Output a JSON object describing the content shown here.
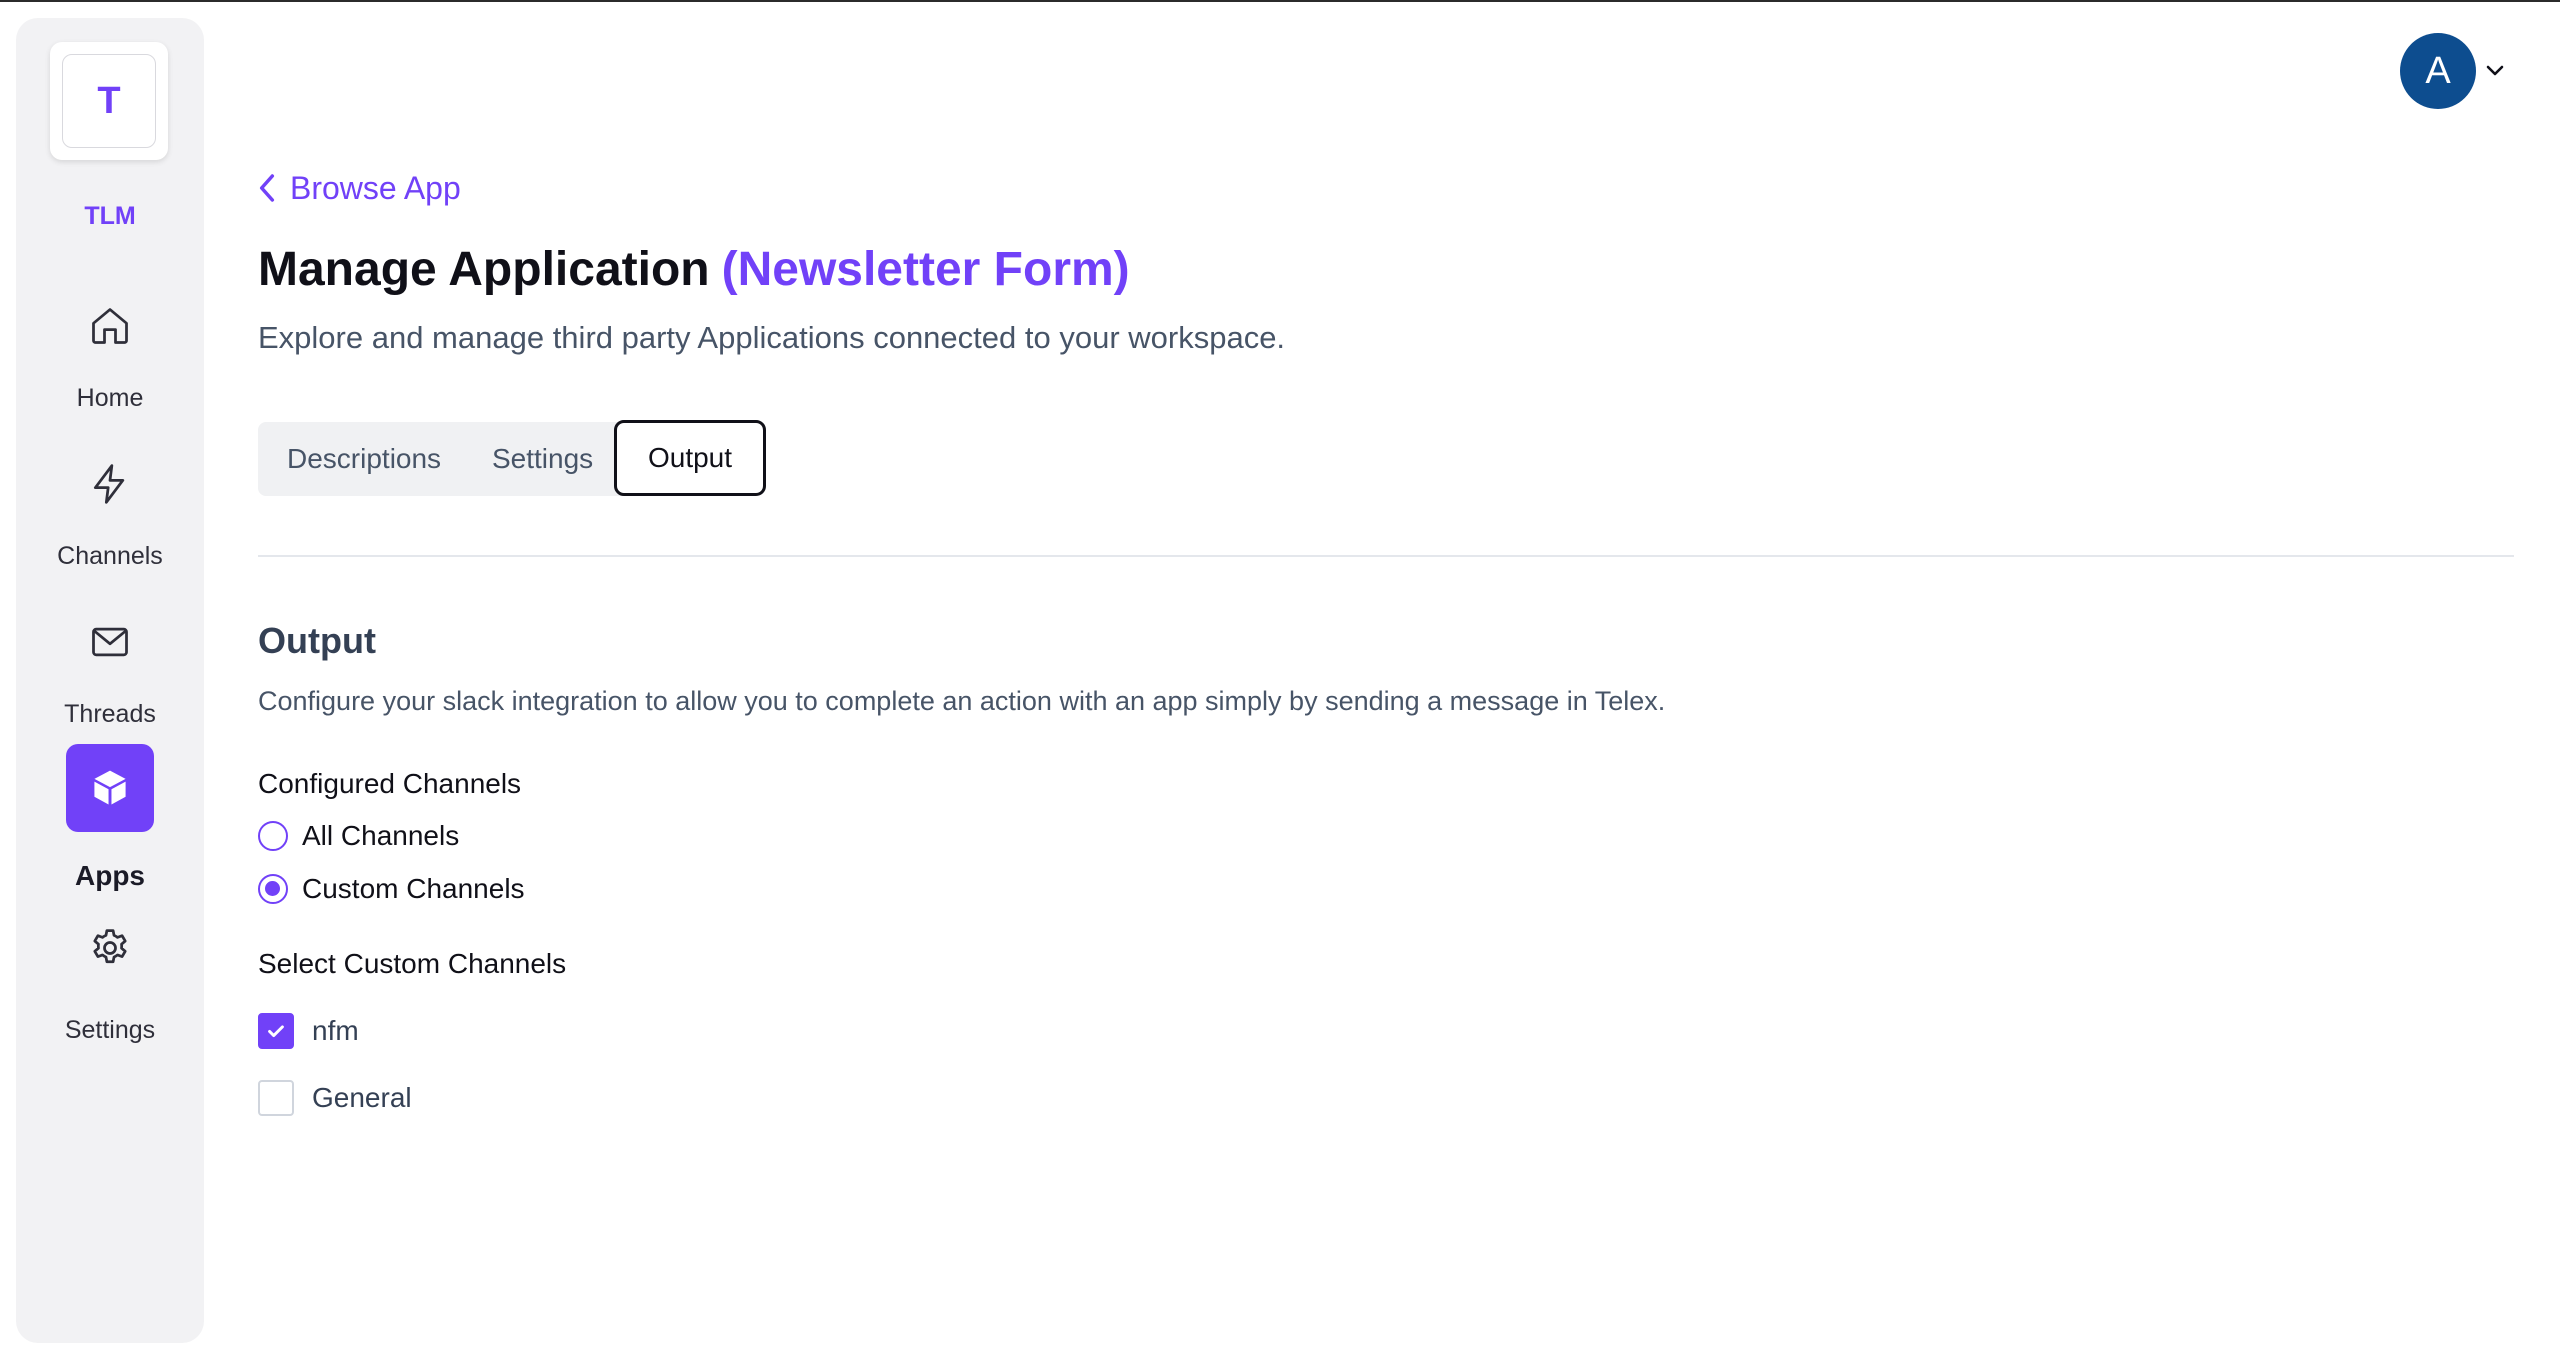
{
  "workspace": {
    "initial": "T",
    "name": "TLM"
  },
  "sidebar": {
    "items": [
      {
        "label": "Home",
        "icon": "home-icon",
        "active": false
      },
      {
        "label": "Channels",
        "icon": "lightning-icon",
        "active": false
      },
      {
        "label": "Threads",
        "icon": "mail-icon",
        "active": false
      },
      {
        "label": "Apps",
        "icon": "cube-icon",
        "active": true
      },
      {
        "label": "Settings",
        "icon": "gear-icon",
        "active": false
      }
    ]
  },
  "user": {
    "avatar_initial": "A"
  },
  "breadcrumb": {
    "back_label": "Browse App"
  },
  "header": {
    "title": "Manage Application",
    "app_name": "(Newsletter Form)",
    "subtitle": "Explore and manage third party Applications connected to your workspace."
  },
  "tabs": [
    {
      "label": "Descriptions",
      "active": false
    },
    {
      "label": "Settings",
      "active": false
    },
    {
      "label": "Output",
      "active": true
    }
  ],
  "output": {
    "title": "Output",
    "description": "Configure your slack integration to allow you to complete an action with an app simply by sending a message in Telex.",
    "configured_label": "Configured Channels",
    "radio_options": [
      {
        "label": "All Channels",
        "checked": false
      },
      {
        "label": "Custom Channels",
        "checked": true
      }
    ],
    "custom_label": "Select Custom Channels",
    "channels": [
      {
        "label": "nfm",
        "checked": true
      },
      {
        "label": "General",
        "checked": false
      }
    ]
  },
  "colors": {
    "accent": "#7141f8",
    "avatar": "#0d4d8f"
  }
}
